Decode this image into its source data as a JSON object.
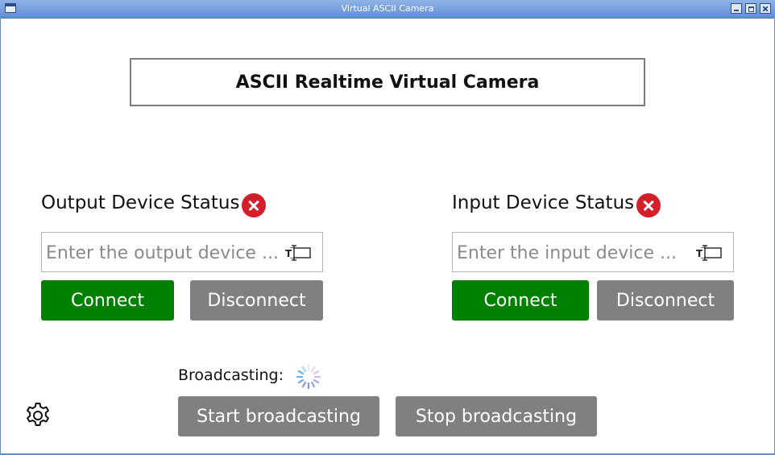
{
  "window": {
    "title": "Virtual ASCII Camera",
    "controls": [
      "minimize",
      "maximize",
      "close"
    ]
  },
  "header": {
    "title": "ASCII Realtime Virtual Camera"
  },
  "output": {
    "status_label": "Output Device Status",
    "status_icon": "error-icon",
    "placeholder": "Enter the output device ...",
    "connect_label": "Connect",
    "disconnect_label": "Disconnect"
  },
  "input": {
    "status_label": "Input Device Status",
    "status_icon": "error-icon",
    "placeholder": "Enter the input device ...",
    "connect_label": "Connect",
    "disconnect_label": "Disconnect"
  },
  "broadcast": {
    "label": "Broadcasting:",
    "start_label": "Start broadcasting",
    "stop_label": "Stop broadcasting"
  },
  "colors": {
    "connect": "#008000",
    "secondary": "#808080",
    "error": "#d21f2b",
    "titlebar": "#6f9bde"
  }
}
